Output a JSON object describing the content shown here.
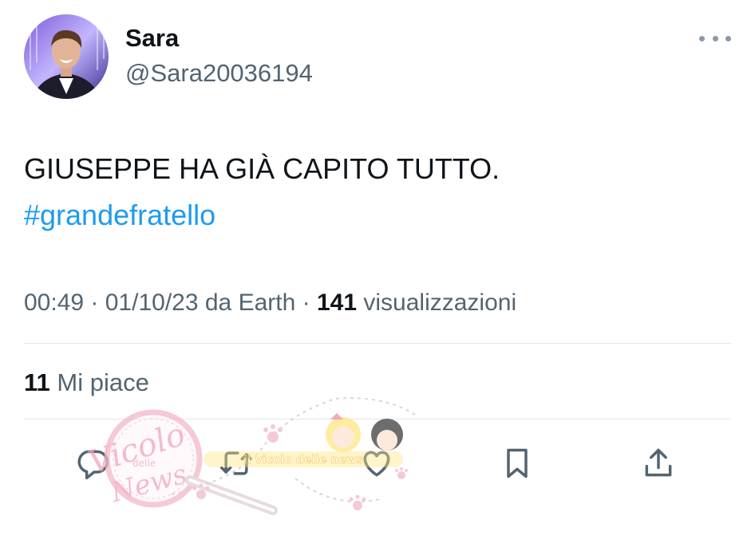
{
  "tweet": {
    "author": {
      "name": "Sara",
      "handle": "@Sara20036194"
    },
    "text": "GIUSEPPE HA GIÀ CAPITO TUTTO.",
    "hashtag": "#grandefratello",
    "time": "00:49",
    "date": "01/10/23",
    "source": "da Earth",
    "views_count": "141",
    "views_label": "visualizzazioni",
    "likes_count": "11",
    "likes_label": "Mi piace"
  },
  "actions": {
    "icons": [
      "reply-icon",
      "retweet-icon",
      "like-icon",
      "bookmark-icon",
      "share-icon"
    ]
  },
  "colors": {
    "hashtag": "#1d9bf0",
    "secondary_text": "#536471",
    "icon": "#536471",
    "divider": "#e1e5e8",
    "watermark_pink": "#f4b6c8"
  },
  "watermark": {
    "logo_text": "Vicolo delle News",
    "banner_text": "il vicolo delle news"
  }
}
